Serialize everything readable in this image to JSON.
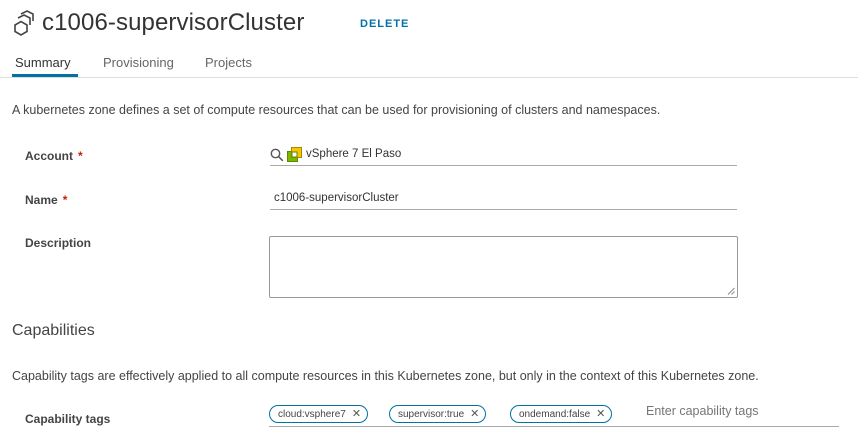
{
  "header": {
    "title": "c1006-supervisorCluster",
    "delete_label": "DELETE"
  },
  "tabs": [
    {
      "label": "Summary",
      "active": true
    },
    {
      "label": "Provisioning",
      "active": false
    },
    {
      "label": "Projects",
      "active": false
    }
  ],
  "intro": "A kubernetes zone defines a set of compute resources that can be used for provisioning of clusters and namespaces.",
  "form": {
    "account": {
      "label": "Account",
      "required_mark": "*",
      "value": "vSphere 7 El Paso"
    },
    "name": {
      "label": "Name",
      "required_mark": "*",
      "value": "c1006-supervisorCluster"
    },
    "description": {
      "label": "Description",
      "value": ""
    }
  },
  "capabilities": {
    "heading": "Capabilities",
    "description": "Capability tags are effectively applied to all compute resources in this Kubernetes zone, but only in the context of this Kubernetes zone.",
    "tags_label": "Capability tags",
    "tags": [
      "cloud:vsphere7",
      "supervisor:true",
      "ondemand:false"
    ],
    "tags_placeholder": "Enter capability tags"
  },
  "colors": {
    "accent": "#0072a3",
    "required": "#c92100",
    "vsphere_icon": "#7ab800"
  },
  "icons": {
    "header": "kubernetes-zone-icon",
    "search": "search-icon",
    "account": "vsphere-icon"
  }
}
